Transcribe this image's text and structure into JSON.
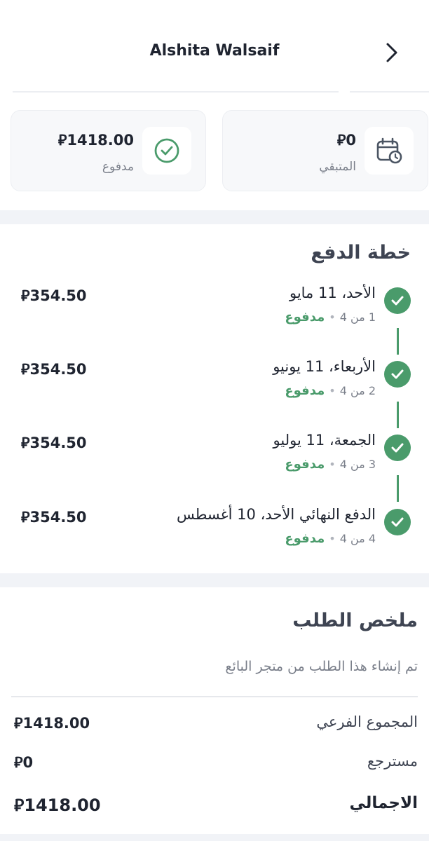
{
  "header": {
    "title": "Alshita Walsaif"
  },
  "summary_cards": {
    "remaining": {
      "amount": "0",
      "currency": "⃁",
      "label": "المتبقي"
    },
    "paid": {
      "amount": "1418.00",
      "currency": "⃁",
      "label": "مدفوع"
    }
  },
  "payment_plan": {
    "title": "خطة الدفع",
    "items": [
      {
        "date": "الأحد، 11 مايو",
        "status": "مدفوع",
        "count": "1 من 4",
        "amount": "354.50"
      },
      {
        "date": "الأربعاء، 11 يونيو",
        "status": "مدفوع",
        "count": "2 من 4",
        "amount": "354.50"
      },
      {
        "date": "الجمعة، 11 يوليو",
        "status": "مدفوع",
        "count": "3 من 4",
        "amount": "354.50"
      },
      {
        "date": "الدفع النهائي الأحد، 10 أغسطس",
        "status": "مدفوع",
        "count": "4 من 4",
        "amount": "354.50"
      }
    ]
  },
  "order_summary": {
    "title": "ملخص الطلب",
    "created_note": "تم إنشاء هذا الطلب من متجر البائع",
    "subtotal_label": "المجموع الفرعي",
    "subtotal_value": "1418.00",
    "refund_label": "مسترجع",
    "refund_value": "0",
    "total_label": "الاجمالي",
    "total_value": "1418.00"
  },
  "colors": {
    "accent_green": "#4a9b6b",
    "band": "#f1f3f7",
    "card_bg": "#f7f8fa"
  },
  "icons": {
    "back": "chevron-right-icon",
    "remaining": "calendar-clock-icon",
    "paid": "check-circle-icon",
    "plan_item": "check-icon"
  }
}
